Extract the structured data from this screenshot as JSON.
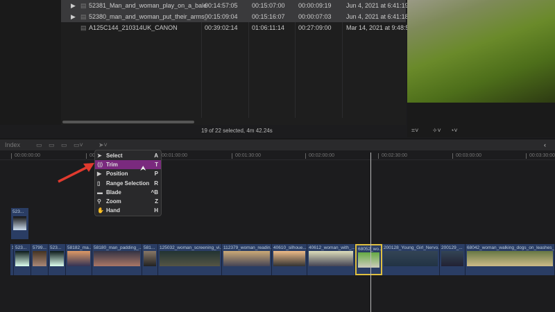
{
  "browser": {
    "rows": [
      {
        "name": "52381_Man_and_woman_play_on_a_bale_o...",
        "start": "00:14:57:05",
        "end": "00:15:07:00",
        "duration": "00:00:09:19",
        "date": "Jun 4, 2021 at 6:41:19",
        "expandable": true
      },
      {
        "name": "52380_man_and_woman_put_their_arms_a...",
        "start": "00:15:09:04",
        "end": "00:15:16:07",
        "duration": "00:00:07:03",
        "date": "Jun 4, 2021 at 6:41:18",
        "expandable": true
      },
      {
        "name": "A125C144_210314UK_CANON",
        "start": "00:39:02:14",
        "end": "01:06:11:14",
        "duration": "00:27:09:00",
        "date": "Mar 14, 2021 at 9:48:5",
        "expandable": false
      }
    ],
    "status": "19 of 22 selected, 4m 42.24s"
  },
  "timeline": {
    "index_label": "Index",
    "ruler": [
      "00:00:00:00",
      "00:00:30:00",
      "00:01:00:00",
      "00:01:30:00",
      "00:02:00:00",
      "00:02:30:00",
      "00:03:00:00",
      "00:03:30:00"
    ],
    "connected_clip": "523...",
    "clips": [
      "1",
      "523...",
      "5799...",
      "523...",
      "58182_ma...",
      "58180_man_padding_...",
      "581...",
      "125032_woman_screening_vi...",
      "112379_woman_readin...",
      "40610_silhoue...",
      "40612_woman_with_...",
      "68052_wo...",
      "200128_Young_Girl_Nervo...",
      "200129_...",
      "68042_woman_walking_dogs_on_leashes_on..."
    ],
    "selected_clip": "68052_wo..."
  },
  "tool_menu": [
    {
      "label": "Select",
      "key": "A",
      "icon": "arrow-icon"
    },
    {
      "label": "Trim",
      "key": "T",
      "icon": "trim-icon",
      "active": true
    },
    {
      "label": "Position",
      "key": "P",
      "icon": "position-icon"
    },
    {
      "label": "Range Selection",
      "key": "R",
      "icon": "range-icon"
    },
    {
      "label": "Blade",
      "key": "^B",
      "icon": "blade-icon"
    },
    {
      "label": "Zoom",
      "key": "Z",
      "icon": "magnifier-icon"
    },
    {
      "label": "Hand",
      "key": "H",
      "icon": "hand-icon"
    }
  ],
  "colors": {
    "accent": "#7a2a7e",
    "selection": "#e0c040",
    "clip": "#2a3d64"
  }
}
